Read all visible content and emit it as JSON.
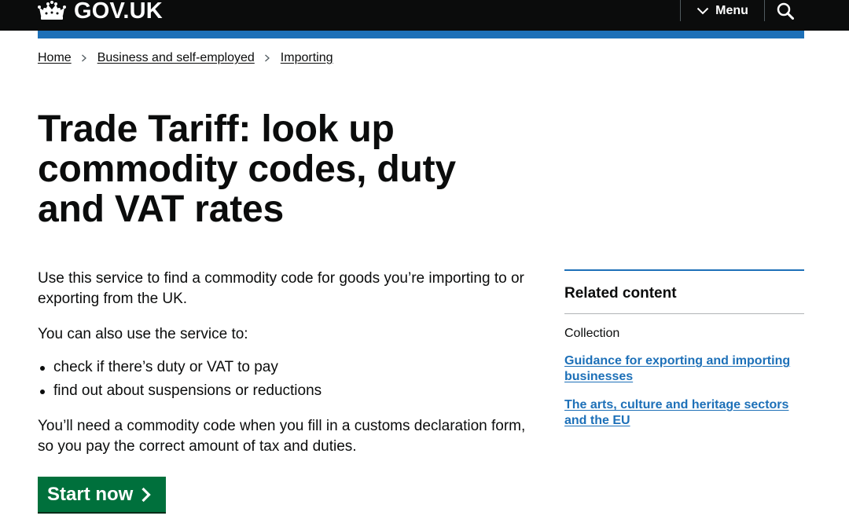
{
  "header": {
    "logo_text": "GOV.UK",
    "menu_label": "Menu",
    "logo_icon": "crown-icon",
    "menu_icon": "chevron-down-icon",
    "search_icon": "search-icon",
    "colors": {
      "background": "#0b0c0c",
      "accent_bar": "#1d70b8"
    }
  },
  "breadcrumb": {
    "items": [
      "Home",
      "Business and self-employed",
      "Importing"
    ]
  },
  "page": {
    "title": "Trade Tariff: look up commodity codes, duty and VAT rates",
    "intro": "Use this service to find a commodity code for goods you’re importing to or exporting from the UK.",
    "also_use": "You can also use the service to:",
    "bullets": [
      "check if there’s duty or VAT to pay",
      "find out about suspensions or reductions"
    ],
    "need_code": "You’ll need a commodity code when you fill in a customs declaration form, so you pay the correct amount of tax and duties.",
    "start_button": "Start now",
    "start_button_color": "#00703c"
  },
  "related": {
    "heading": "Related content",
    "collection_label": "Collection",
    "links": [
      "Guidance for exporting and importing businesses",
      "The arts, culture and heritage sectors and the EU"
    ],
    "link_color": "#1d70b8"
  }
}
